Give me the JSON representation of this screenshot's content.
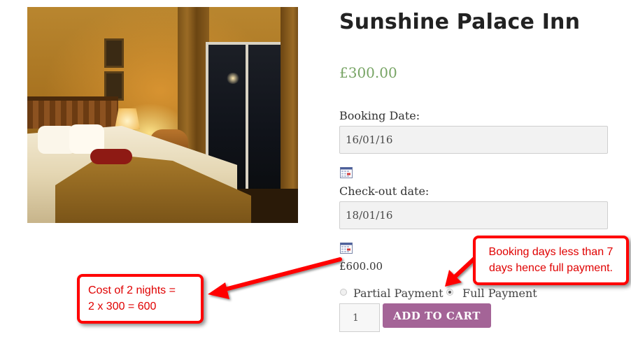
{
  "product": {
    "title": "Sunshine Palace Inn",
    "price": "£300.00",
    "image_alt": "hotel room"
  },
  "booking": {
    "booking_date_label": "Booking Date:",
    "booking_date_value": "16/01/16",
    "checkout_label": "Check-out date:",
    "checkout_value": "18/01/16",
    "total_price": "£600.00",
    "payment_options": [
      {
        "label": "Partial Payment",
        "selected": false
      },
      {
        "label": "Full Payment",
        "selected": true
      }
    ],
    "quantity": "1",
    "add_to_cart_label": "ADD TO CART"
  },
  "annotations": {
    "cost_line_1": "Cost of 2 nights =",
    "cost_line_2": "2 x 300 = 600",
    "days_line_1": "Booking days less than 7",
    "days_line_2": "days hence full payment."
  },
  "colors": {
    "price_green": "#77a464",
    "button_purple": "#a46497",
    "annotation_red": "#ff0000"
  },
  "icons": [
    "calendar-icon",
    "calendar-icon",
    "radio-icon"
  ]
}
